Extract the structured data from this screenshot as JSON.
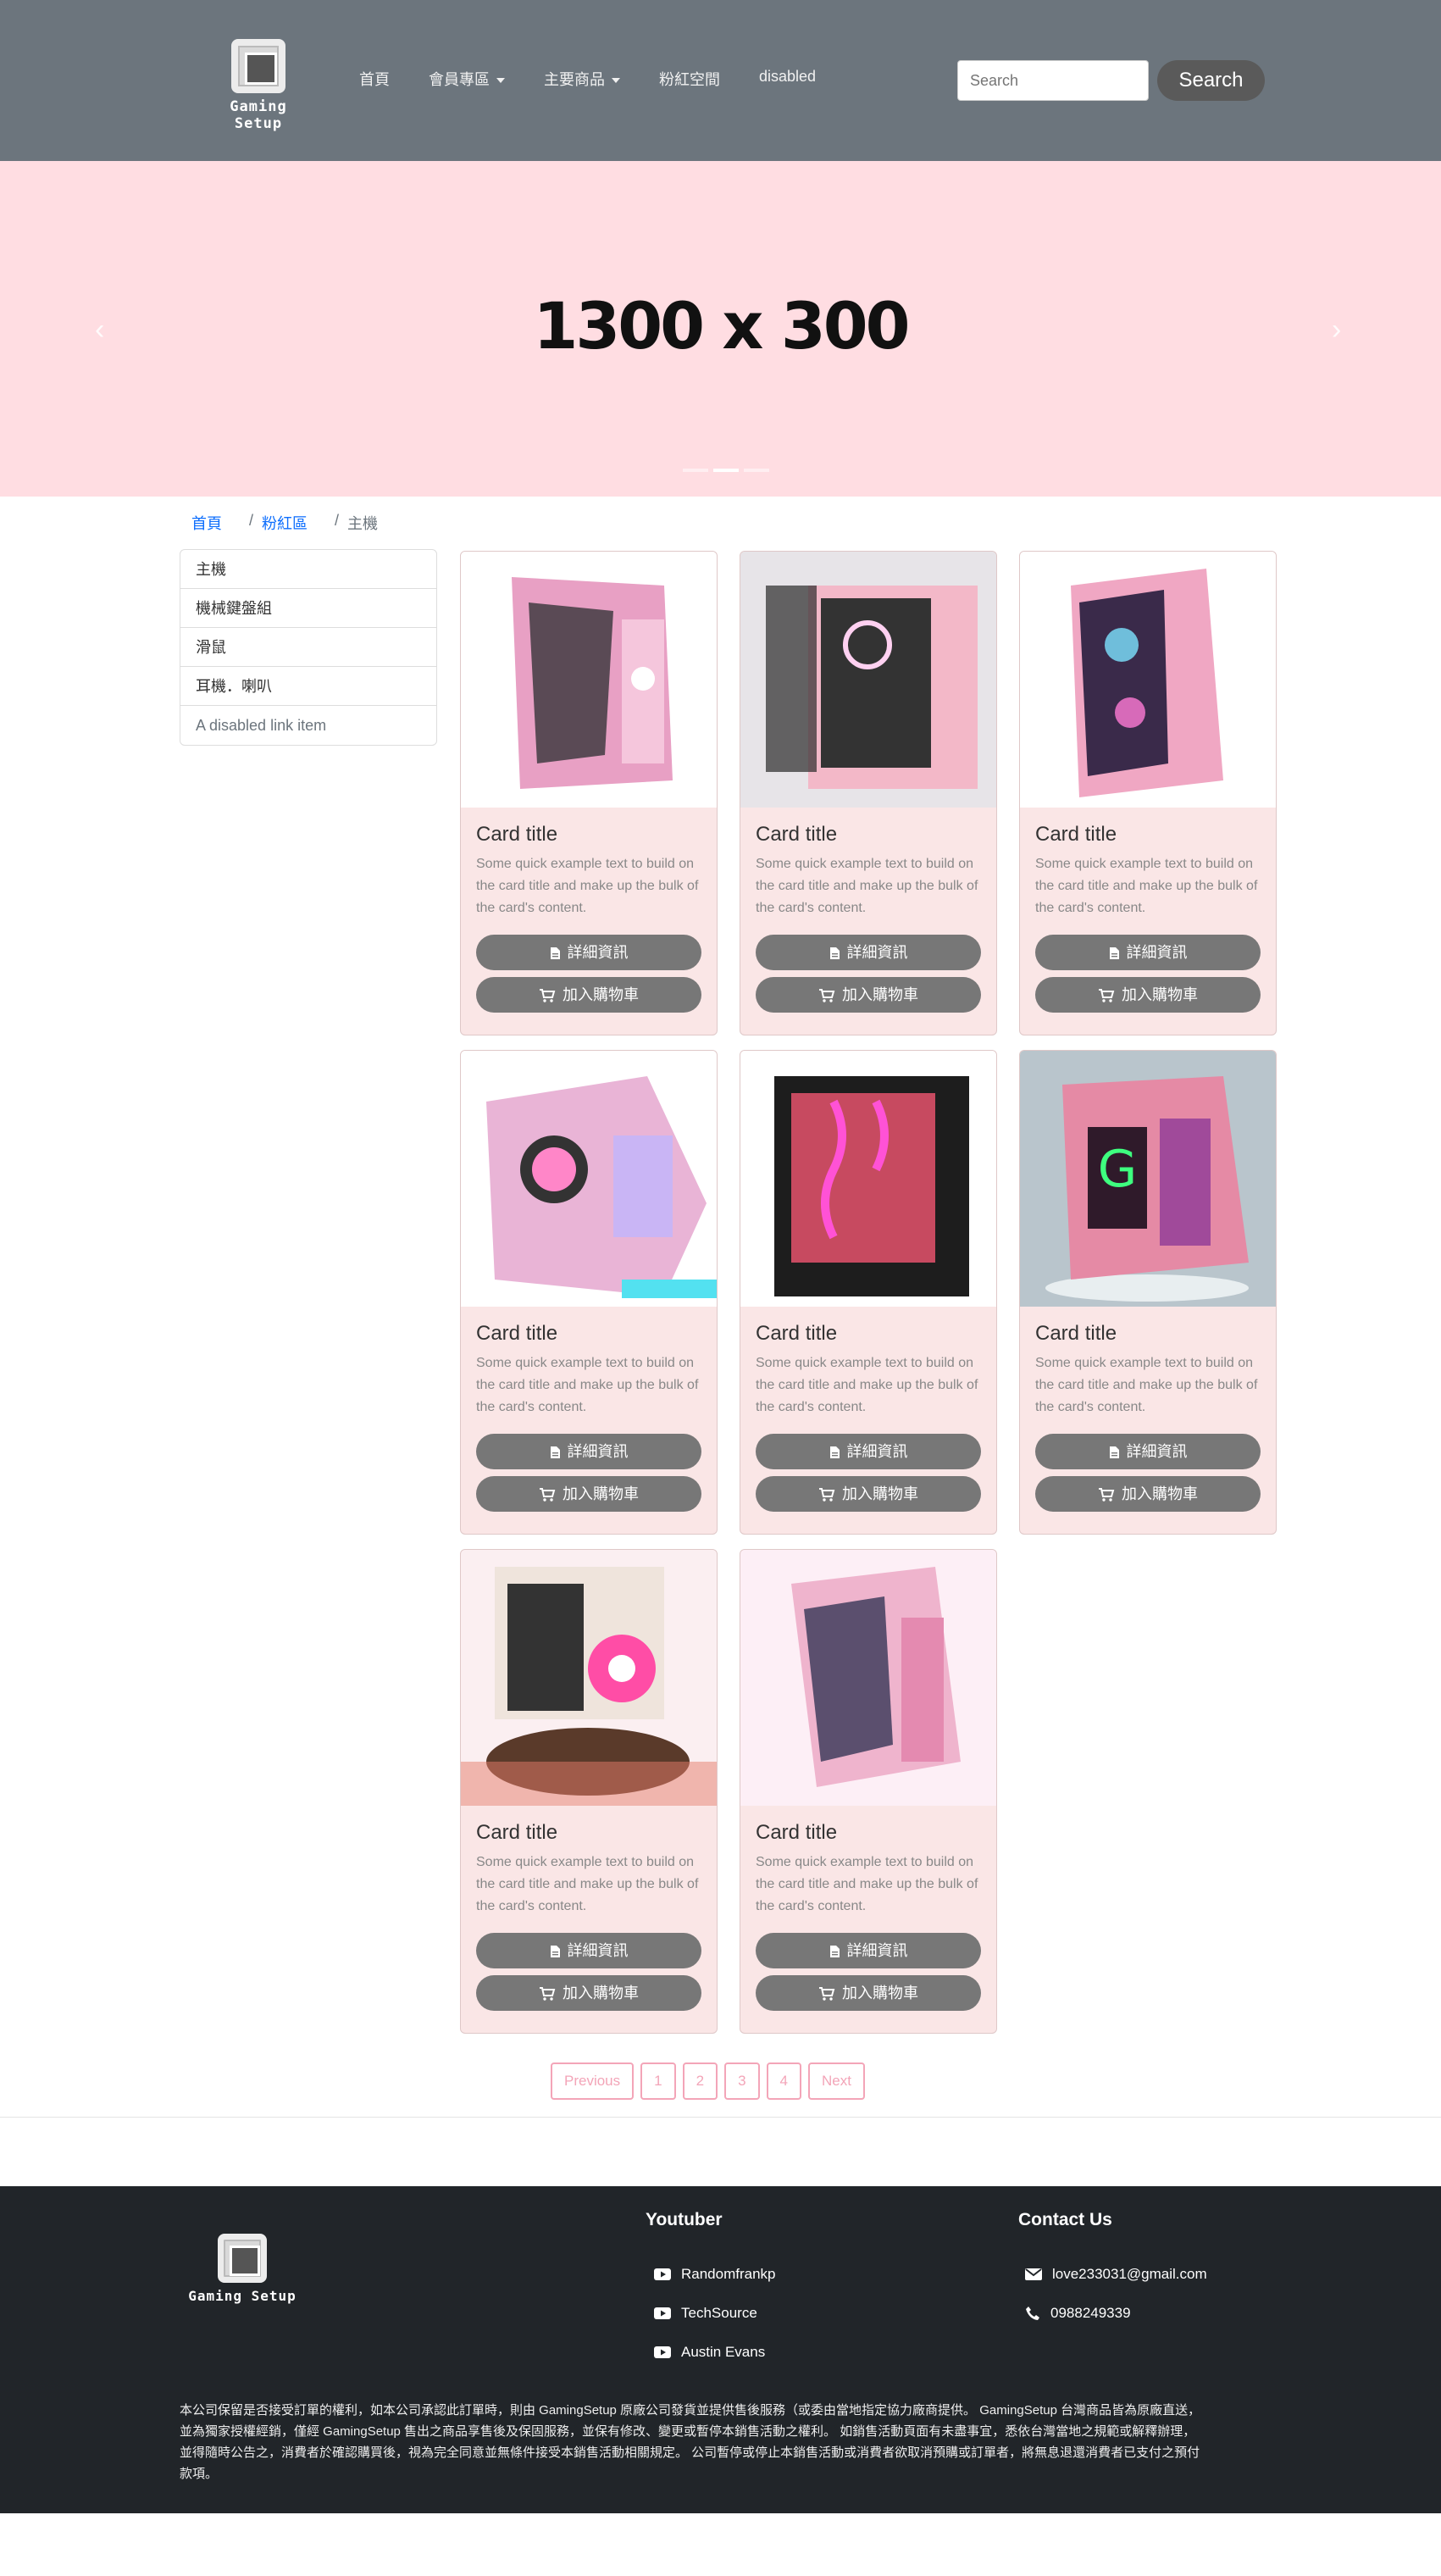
{
  "header": {
    "logo_text": "Gaming Setup",
    "nav": [
      {
        "label": "首頁",
        "dropdown": false
      },
      {
        "label": "會員專區",
        "dropdown": true
      },
      {
        "label": "主要商品",
        "dropdown": true
      },
      {
        "label": "粉紅空間",
        "dropdown": false
      },
      {
        "label": "disabled",
        "dropdown": false
      }
    ],
    "search_placeholder": "Search",
    "search_button": "Search"
  },
  "hero": {
    "text": "1300 x 300",
    "background": "#ffdde2",
    "slides": 3,
    "active_slide": 2
  },
  "breadcrumb": [
    "首頁",
    "粉紅區",
    "主機"
  ],
  "sidebar": [
    "主機",
    "機械鍵盤組",
    "滑鼠",
    "耳機．喇叭",
    "A disabled link item"
  ],
  "card_common": {
    "title": "Card title",
    "text": "Some quick example text to build on the card title and make up the bulk of the card's content.",
    "detail_button": "詳細資訊",
    "cart_button": "加入購物車"
  },
  "cards": [
    {
      "image": "pink-case-1"
    },
    {
      "image": "pink-case-2"
    },
    {
      "image": "pink-case-3"
    },
    {
      "image": "pink-case-4"
    },
    {
      "image": "pink-case-5"
    },
    {
      "image": "pink-case-6"
    },
    {
      "image": "pink-case-7"
    },
    {
      "image": "pink-case-8"
    }
  ],
  "pagination": [
    "Previous",
    "1",
    "2",
    "3",
    "4",
    "Next"
  ],
  "footer": {
    "logo_text": "Gaming Setup",
    "youtuber_heading": "Youtuber",
    "youtubers": [
      "Randomfrankp",
      "TechSource",
      "Austin Evans"
    ],
    "contact_heading": "Contact Us",
    "email": "love233031@gmail.com",
    "phone": "0988249339",
    "notice_lines": [
      "本公司保留是否接受訂單的權利，如本公司承認此訂單時，則由 GamingSetup 原廠公司發貨並提供售後服務（或委由當地指定協力廠商提供。 GamingSetup 台灣商品皆為原廠直送，",
      "並為獨家授權經銷，僅經 GamingSetup 售出之商品享售後及保固服務，並保有修改、變更或暫停本銷售活動之權利。 如銷售活動頁面有未盡事宜，悉依台灣當地之規範或解釋辦理，",
      "並得隨時公告之，消費者於確認購買後，視為完全同意並無條件接受本銷售活動相關規定。 公司暫停或停止本銷售活動或消費者欲取消預購或訂單者，將無息退還消費者已支付之預付",
      "款項。"
    ]
  },
  "colors": {
    "navbar": "#6c757d",
    "card_bg": "#fae6e6",
    "button": "#777777",
    "pagination": "#f3a5b8",
    "footer": "#212529",
    "link": "#0d6efd"
  }
}
